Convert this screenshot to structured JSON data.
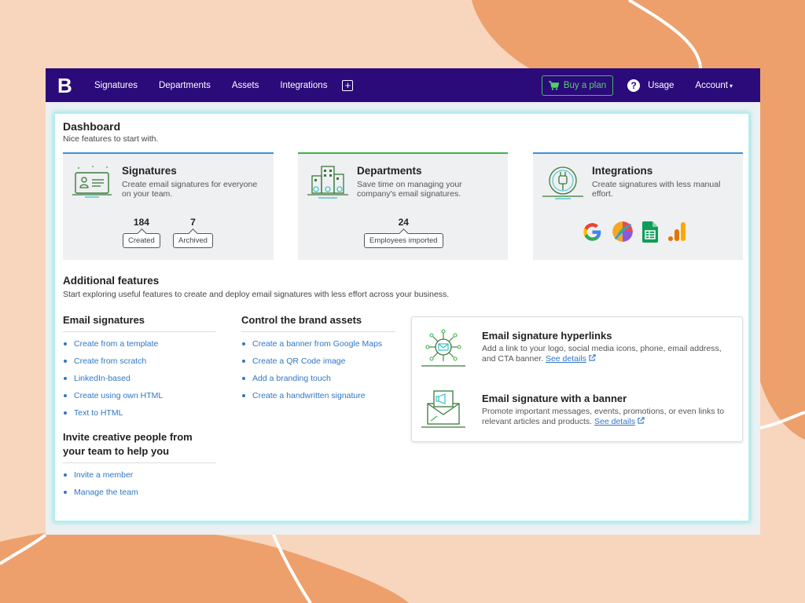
{
  "nav": {
    "logo": "B",
    "items": [
      "Signatures",
      "Departments",
      "Assets",
      "Integrations"
    ],
    "plus": "+",
    "buy": "Buy a plan",
    "help": "?",
    "usage": "Usage",
    "account": "Account"
  },
  "dashboard": {
    "title": "Dashboard",
    "subtitle": "Nice features to start with."
  },
  "cards": {
    "signatures": {
      "title": "Signatures",
      "desc": "Create email signatures for everyone on your team.",
      "created_num": "184",
      "created_label": "Created",
      "archived_num": "7",
      "archived_label": "Archived"
    },
    "departments": {
      "title": "Departments",
      "desc": "Save time on managing your company's email signatures.",
      "employees_num": "24",
      "employees_label": "Employees imported"
    },
    "integrations": {
      "title": "Integrations",
      "desc": "Create signatures with less manual effort.",
      "logos": [
        "google-icon",
        "freshworks-icon",
        "google-sheets-icon",
        "google-analytics-icon"
      ]
    }
  },
  "additional": {
    "title": "Additional features",
    "subtitle": "Start exploring useful features to create and deploy email signatures with less effort across your business."
  },
  "email_signatures": {
    "title": "Email signatures",
    "items": [
      "Create from a template",
      "Create from scratch",
      "LinkedIn-based",
      "Create using own HTML",
      "Text to HTML"
    ]
  },
  "invite": {
    "title_line1": "Invite creative people from",
    "title_line2": "your team to help you",
    "items": [
      "Invite a member",
      "Manage the team"
    ]
  },
  "brand": {
    "title": "Control the brand assets",
    "items": [
      "Create a banner from Google Maps",
      "Create a QR Code image",
      "Add a branding touch",
      "Create a handwritten signature"
    ]
  },
  "features": {
    "hyperlinks": {
      "title": "Email signature hyperlinks",
      "desc": "Add a link to your logo, social media icons, phone, email address, and CTA banner.",
      "link": "See details"
    },
    "banner": {
      "title": "Email signature with a banner",
      "desc": "Promote important messages, events, promotions, or even links to relevant articles and products.",
      "link": "See details"
    }
  },
  "colors": {
    "nav_bg": "#2b0a7a",
    "link": "#2f77c4",
    "accent_green": "#3ab54a",
    "accent_blue": "#3a8fd8",
    "page_bg": "#f8d5bd",
    "blob": "#eda06c"
  }
}
